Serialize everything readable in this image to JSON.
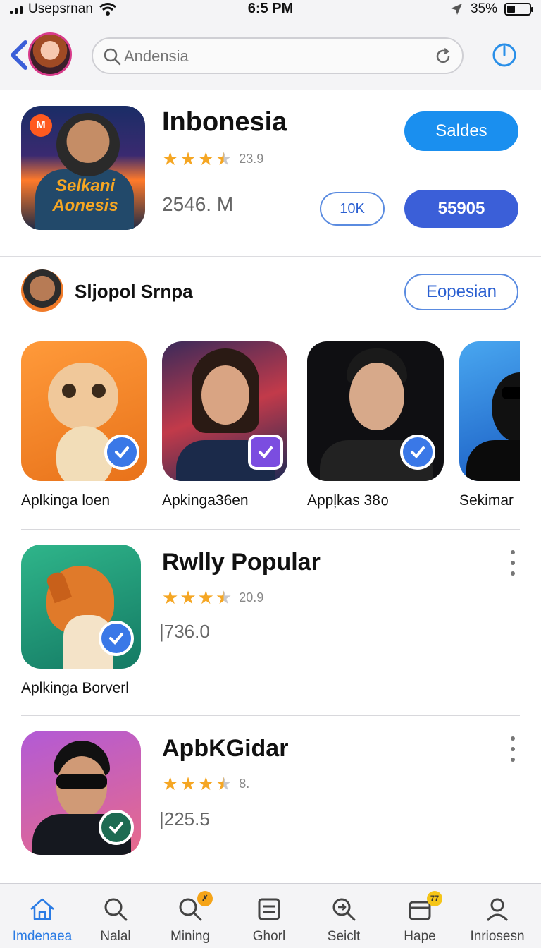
{
  "status_bar": {
    "carrier": "Usepsrnan",
    "time": "6:5 PM",
    "battery": "35%",
    "battery_level": 0.35
  },
  "header": {
    "search_placeholder": "Andensia"
  },
  "featured": {
    "badge": "M",
    "art_text": "Selkani Aonesis",
    "title": "Inbonesia",
    "rating": 3.5,
    "rating_value": "23.9",
    "size": "2546. M",
    "primary_button": "Saldes",
    "secondary_button": "10K",
    "count_button": "55905"
  },
  "section": {
    "title": "Sljopol Srnpa",
    "button": "Eopesian"
  },
  "carousel": [
    {
      "label": "Aplkinga loen",
      "check": "blue"
    },
    {
      "label": "Apkinga36en",
      "check": "purple"
    },
    {
      "label": "Appļkas 38൦",
      "check": "blue"
    },
    {
      "label": "Sekimar",
      "check": "none"
    }
  ],
  "list": [
    {
      "title": "Rwlly Popular",
      "rating": 3.5,
      "rating_value": "20.9",
      "size": "|736.0",
      "label": "Aplkinga Borverl"
    },
    {
      "title": "ApbKGidar",
      "rating": 3.5,
      "rating_value": "8.",
      "size": "|225.5",
      "label": ""
    }
  ],
  "tabs": [
    {
      "label": "Imdenaea",
      "icon": "home-icon",
      "active": true
    },
    {
      "label": "Nalal",
      "icon": "search-icon"
    },
    {
      "label": "Mining",
      "icon": "search-badge-icon",
      "badge": "✗"
    },
    {
      "label": "Ghorl",
      "icon": "document-icon"
    },
    {
      "label": "Seiclt",
      "icon": "search-arrow-icon"
    },
    {
      "label": "Hape",
      "icon": "box-icon",
      "badge": "77"
    },
    {
      "label": "Inriosesn",
      "icon": "person-icon"
    }
  ],
  "colors": {
    "accent": "#1a8fef",
    "primary_dark": "#3b5fd8",
    "star": "#f5a623",
    "active_tab": "#2a7be4"
  }
}
